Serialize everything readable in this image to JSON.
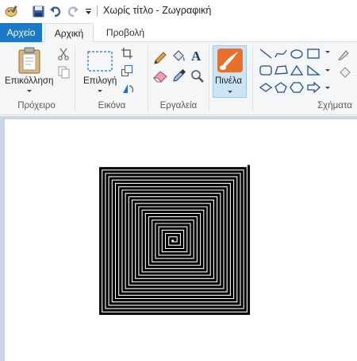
{
  "window": {
    "title": "Χωρίς τίτλο - Ζωγραφική"
  },
  "quick_access": {
    "app_icon": "paint-palette-icon",
    "save_icon": "save-icon",
    "undo_icon": "undo-icon",
    "redo_icon": "redo-icon",
    "customize_icon": "customize-dropdown-icon"
  },
  "tabs": {
    "file": "Αρχείο",
    "home": "Αρχική",
    "view": "Προβολή"
  },
  "ribbon": {
    "clipboard": {
      "paste_label": "Επικόλληση",
      "group_label": "Πρόχειρο"
    },
    "image": {
      "select_label": "Επιλογή",
      "group_label": "Εικόνα"
    },
    "tools": {
      "group_label": "Εργαλεία"
    },
    "brushes": {
      "label": "Πινέλα"
    },
    "shapes": {
      "group_label": "Σχήματα"
    }
  },
  "colors": {
    "accent": "#1979ca",
    "ribbon_bg": "#f5f6f7",
    "canvas_bg": "#c9d6e6",
    "selected_bg": "#cce4f7"
  }
}
